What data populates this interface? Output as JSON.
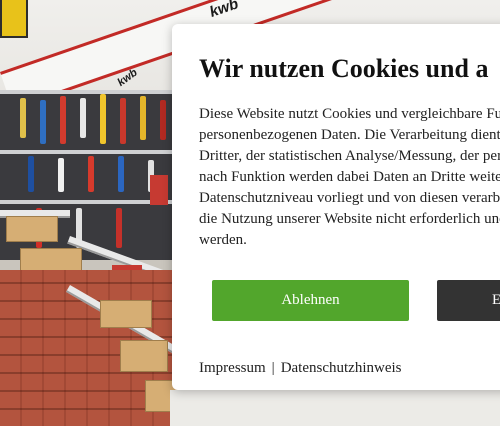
{
  "background": {
    "brand_text": "kwb",
    "colors": {
      "brand_red": "#c22a26",
      "floor": "#b3543e"
    }
  },
  "cookie_dialog": {
    "title": "Wir nutzen Cookies und a",
    "body_lines": [
      "Diese Website nutzt Cookies und vergleichbare Fu",
      "personenbezogenen Daten. Die Verarbeitung dient",
      "Dritter, der statistischen Analyse/Messung, der per",
      "nach Funktion werden dabei Daten an Dritte weite",
      "Datenschutzniveau vorliegt und von diesen verarb",
      "die Nutzung unserer Website nicht erforderlich und",
      "werden."
    ],
    "decline_label": "Ablehnen",
    "accept_label": "E",
    "footer": {
      "imprint_label": "Impressum",
      "separator": "|",
      "privacy_label": "Datenschutzhinweis"
    },
    "colors": {
      "decline": "#52a62c",
      "accept": "#333333"
    }
  }
}
